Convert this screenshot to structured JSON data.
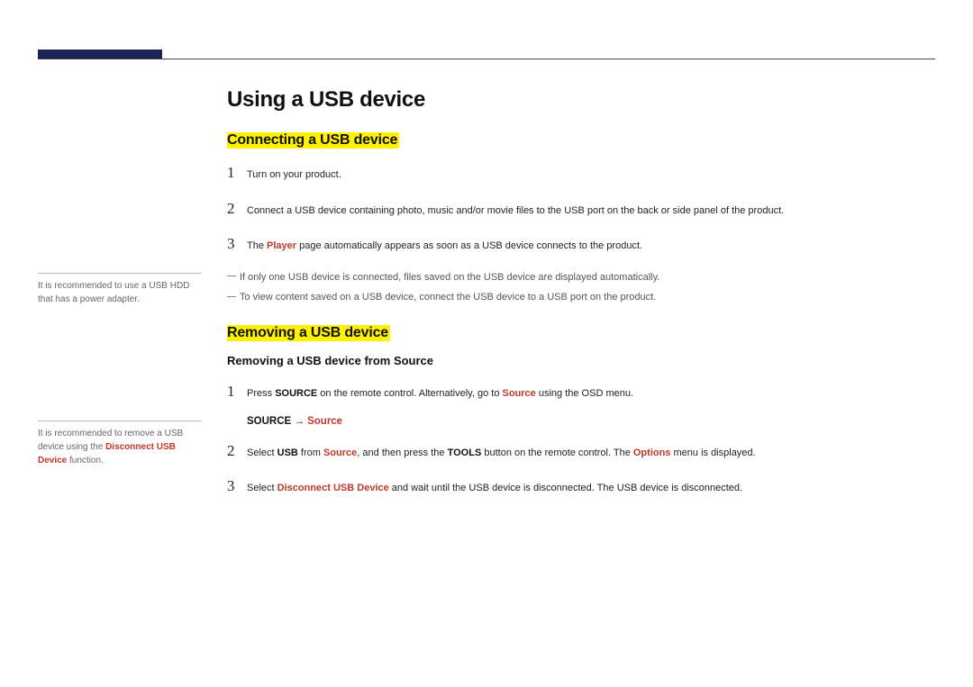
{
  "title": "Using a USB device",
  "section1": {
    "heading": "Connecting a USB device",
    "steps": [
      {
        "num": "1",
        "text": "Turn on your product."
      },
      {
        "num": "2",
        "text": "Connect a USB device containing photo, music and/or movie files to the USB port on the back or side panel of the product."
      },
      {
        "num": "3",
        "pre": "The ",
        "accent": "Player",
        "post": " page automatically appears as soon as a USB device connects to the product."
      }
    ],
    "notes": [
      "If only one USB device is connected, files saved on the USB device are displayed automatically.",
      "To view content saved on a USB device, connect the USB device to a USB port on the product."
    ]
  },
  "section2": {
    "heading": "Removing a USB device",
    "sub": "Removing a USB device from Source",
    "step1": {
      "num": "1",
      "pre": "Press ",
      "b1": "SOURCE",
      "mid": " on the remote control. Alternatively, go to ",
      "a1": "Source",
      "post": " using the OSD menu."
    },
    "nav": {
      "b": "SOURCE",
      "arrow": " → ",
      "a": "Source"
    },
    "step2": {
      "num": "2",
      "pre": "Select ",
      "b1": "USB",
      "m1": " from ",
      "a1": "Source",
      "m2": ", and then press the ",
      "b2": "TOOLS",
      "m3": " button on the remote control. The ",
      "a2": "Options",
      "post": " menu is displayed."
    },
    "step3": {
      "num": "3",
      "pre": "Select ",
      "a1": "Disconnect USB Device",
      "post": " and wait until the USB device is disconnected. The USB device is disconnected."
    }
  },
  "sidebar": {
    "note1": "It is recommended to use a USB HDD that has a power adapter.",
    "note2_pre": "It is recommended to remove a USB device using the ",
    "note2_accent": "Disconnect USB Device",
    "note2_post": " function."
  }
}
